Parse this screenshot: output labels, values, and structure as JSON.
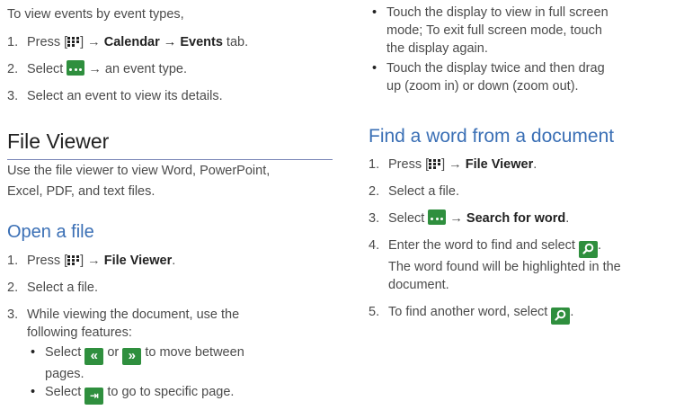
{
  "left": {
    "intro": "To view events by event types,",
    "events_steps": [
      {
        "num": "1.",
        "pre": "Press [",
        "post": "] → ",
        "k1": "Calendar",
        "k2": "Events",
        "tail": " tab."
      },
      {
        "num": "2.",
        "pre": "Select ",
        "post": " → an event type."
      },
      {
        "num": "3.",
        "text": "Select an event to view its details."
      }
    ],
    "section_title": "File Viewer",
    "section_desc_1": "Use the file viewer to view Word, PowerPoint,",
    "section_desc_2": "Excel, PDF, and text files.",
    "open_title": "Open a file",
    "open_steps": [
      {
        "num": "1.",
        "pre": "Press [",
        "post": "] → ",
        "k1": "File Viewer",
        "tail": "."
      },
      {
        "num": "2.",
        "text": "Select a file."
      },
      {
        "num": "3.",
        "text1": "While viewing the document, use the",
        "text2": "following features:"
      }
    ],
    "features": [
      {
        "pre": "Select ",
        "mid": " or ",
        "post": " to move between",
        "line2": "pages."
      },
      {
        "pre": "Select ",
        "post": " to go to specific page."
      }
    ]
  },
  "right": {
    "bullets": [
      {
        "l1": "Touch the display to view in full screen",
        "l2": "mode; To exit full screen mode, touch",
        "l3": "the display again."
      },
      {
        "l1": "Touch the display twice and then drag",
        "l2": "up (zoom in) or down (zoom out)."
      }
    ],
    "find_title": "Find a word from a document",
    "find_steps": [
      {
        "num": "1.",
        "pre": "Press [",
        "post": "] → ",
        "k1": "File Viewer",
        "tail": "."
      },
      {
        "num": "2.",
        "text": "Select a file."
      },
      {
        "num": "3.",
        "pre": "Select ",
        "post": " → ",
        "k1": "Search for word",
        "tail": "."
      },
      {
        "num": "4.",
        "pre": "Enter the word to find and select ",
        "tail": ".",
        "l2": "The word found will be highlighted in the",
        "l3": "document."
      },
      {
        "num": "5.",
        "pre": "To find another word, select ",
        "tail": "."
      }
    ]
  },
  "colors": {
    "heading_blue": "#3a6fb5",
    "icon_green": "#2f8f3e",
    "text": "#4b4b4b"
  },
  "icons": {
    "menu": "apps-grid-icon",
    "more": "more-options-icon",
    "prev": "prev-page-icon",
    "next": "next-page-icon",
    "goto": "go-to-page-icon",
    "search": "search-icon"
  }
}
